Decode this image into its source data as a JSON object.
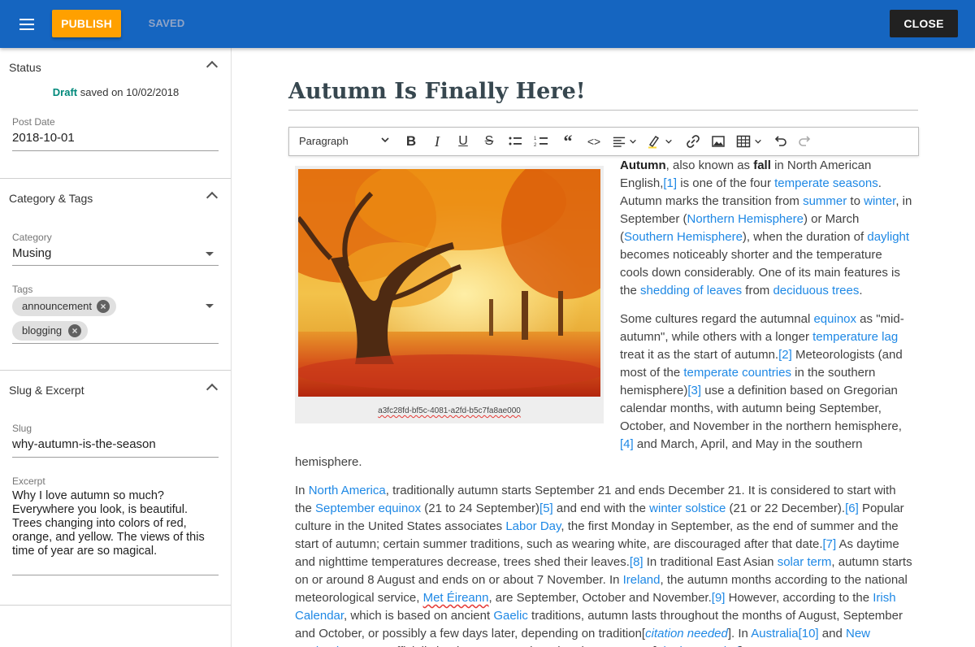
{
  "header": {
    "publish_label": "PUBLISH",
    "saved_label": "SAVED",
    "close_label": "CLOSE",
    "menu_icon": "hamburger-menu-icon"
  },
  "sidebar": {
    "status": {
      "title": "Status",
      "draft": "Draft",
      "saved_on": "saved on 10/02/2018",
      "post_date_label": "Post Date",
      "post_date": "2018-10-01"
    },
    "category_tags": {
      "title": "Category & Tags",
      "category_label": "Category",
      "category": "Musing",
      "tags_label": "Tags",
      "tags": [
        "announcement",
        "blogging"
      ]
    },
    "slug_excerpt": {
      "title": "Slug & Excerpt",
      "slug_label": "Slug",
      "slug": "why-autumn-is-the-season",
      "excerpt_label": "Excerpt",
      "excerpt": "Why I love autumn so much? Everywhere you look, is beautiful. Trees changing into colors of red, orange, and yellow. The views of this time of year are so magical."
    }
  },
  "editor": {
    "title": "Autumn Is Finally Here!",
    "toolbar": {
      "format": "Paragraph"
    },
    "image_caption": "a3fc28fd-bf5c-4081-a2fd-b5c7fa8ae000"
  },
  "colors": {
    "appbar": "#1565c0",
    "publish": "#ffa000",
    "close": "#212121",
    "link": "#1e88e5",
    "draft": "#00897b"
  }
}
